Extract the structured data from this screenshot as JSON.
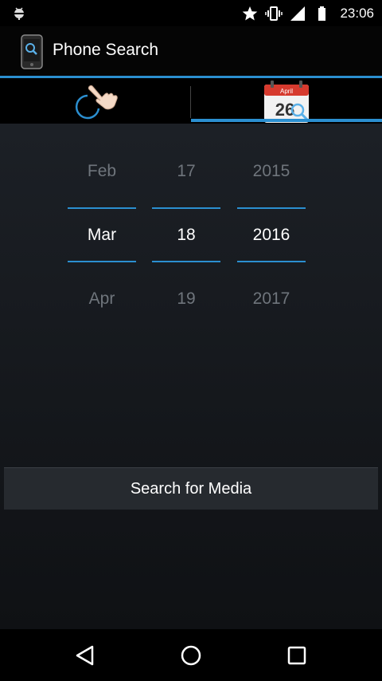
{
  "status_bar": {
    "notification_icon": "android-bug-icon",
    "icons": [
      "star-icon",
      "vibrate-icon",
      "signal-icon",
      "battery-icon"
    ],
    "time": "23:06"
  },
  "action_bar": {
    "app_icon": "phone-search-icon",
    "title": "Phone Search"
  },
  "tabs": [
    {
      "icon": "touch-hand-icon",
      "selected": false
    },
    {
      "icon": "calendar-icon",
      "selected": true,
      "icon_text": "April",
      "icon_day": "26"
    }
  ],
  "date_picker": {
    "month": {
      "prev": "Feb",
      "current": "Mar",
      "next": "Apr"
    },
    "day": {
      "prev": "17",
      "current": "18",
      "next": "19"
    },
    "year": {
      "prev": "2015",
      "current": "2016",
      "next": "2017"
    }
  },
  "search_button": {
    "label": "Search for Media"
  },
  "nav_bar": {
    "buttons": [
      "back-icon",
      "home-icon",
      "recents-icon"
    ]
  },
  "colors": {
    "accent": "#2b8fd0",
    "dim_text": "#6f757c"
  }
}
